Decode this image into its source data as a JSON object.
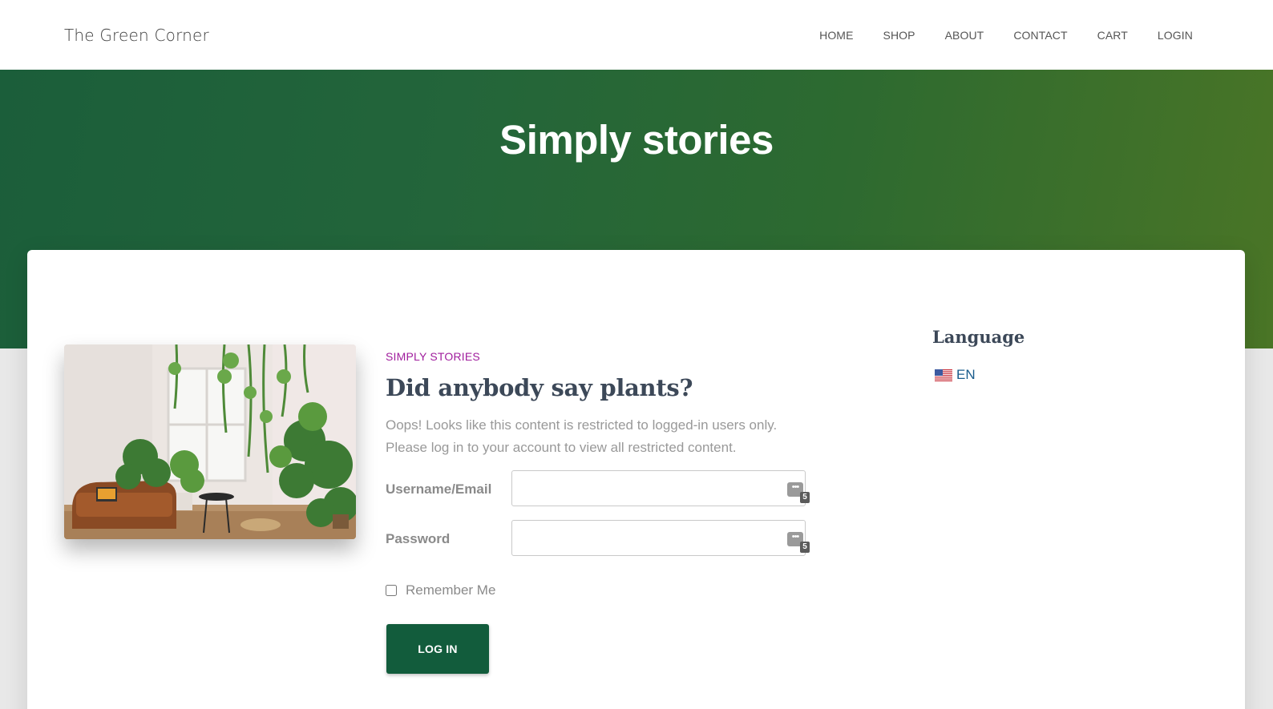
{
  "site": {
    "brand": "The Green Corner"
  },
  "nav": {
    "items": [
      {
        "label": "HOME"
      },
      {
        "label": "SHOP"
      },
      {
        "label": "ABOUT"
      },
      {
        "label": "CONTACT"
      },
      {
        "label": "CART"
      },
      {
        "label": "LOGIN"
      }
    ]
  },
  "hero": {
    "title": "Simply stories"
  },
  "post": {
    "category": "SIMPLY STORIES",
    "title": "Did anybody say plants?",
    "notice_line1": "Oops! Looks like this content is restricted to logged-in users only.",
    "notice_line2": "Please log in to your account to view all restricted content."
  },
  "login_form": {
    "username_label": "Username/Email",
    "username_value": "",
    "password_label": "Password",
    "password_value": "",
    "password_manager_badge": {
      "dots": "•••",
      "count": "5"
    },
    "remember_label": "Remember Me",
    "remember_checked": false,
    "submit_label": "LOG IN"
  },
  "sidebar": {
    "widget_title": "Language",
    "language": {
      "code": "EN",
      "flag": "us-flag-icon"
    }
  },
  "colors": {
    "hero_gradient_start": "#1b5e3a",
    "hero_gradient_end": "#4a7526",
    "button": "#125c3c",
    "category": "#a01d9d",
    "heading": "#3c4858",
    "link": "#1a5c8c"
  }
}
